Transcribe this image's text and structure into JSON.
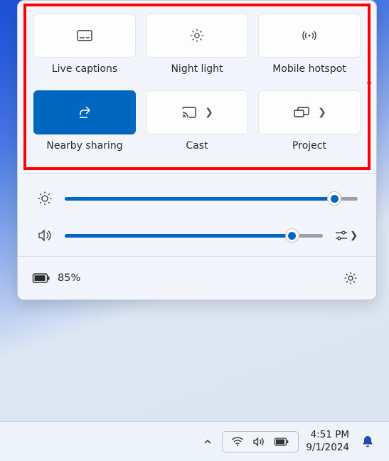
{
  "quickSettings": {
    "tiles": [
      {
        "id": "live-captions",
        "label": "Live captions",
        "icon": "captions-icon",
        "active": false,
        "hasMore": false
      },
      {
        "id": "night-light",
        "label": "Night light",
        "icon": "brightness-icon",
        "active": false,
        "hasMore": false
      },
      {
        "id": "mobile-hotspot",
        "label": "Mobile hotspot",
        "icon": "hotspot-icon",
        "active": false,
        "hasMore": false
      },
      {
        "id": "nearby-sharing",
        "label": "Nearby sharing",
        "icon": "share-icon",
        "active": true,
        "hasMore": false
      },
      {
        "id": "cast",
        "label": "Cast",
        "icon": "cast-icon",
        "active": false,
        "hasMore": true
      },
      {
        "id": "project",
        "label": "Project",
        "icon": "project-icon",
        "active": false,
        "hasMore": true
      }
    ],
    "sliders": {
      "brightness": {
        "icon": "sun-icon",
        "value": 92
      },
      "volume": {
        "icon": "speaker-icon",
        "value": 88,
        "hasOutputSelector": true
      }
    },
    "footer": {
      "batteryIcon": "battery-icon",
      "batteryText": "85%",
      "settingsIcon": "gear-icon"
    },
    "accentColor": "#0067c0"
  },
  "taskbar": {
    "chevronIcon": "chevron-up-icon",
    "trayIcons": [
      "wifi-icon",
      "speaker-icon",
      "battery-icon"
    ],
    "time": "4:51 PM",
    "date": "9/1/2024",
    "notificationIcon": "bell-icon"
  }
}
